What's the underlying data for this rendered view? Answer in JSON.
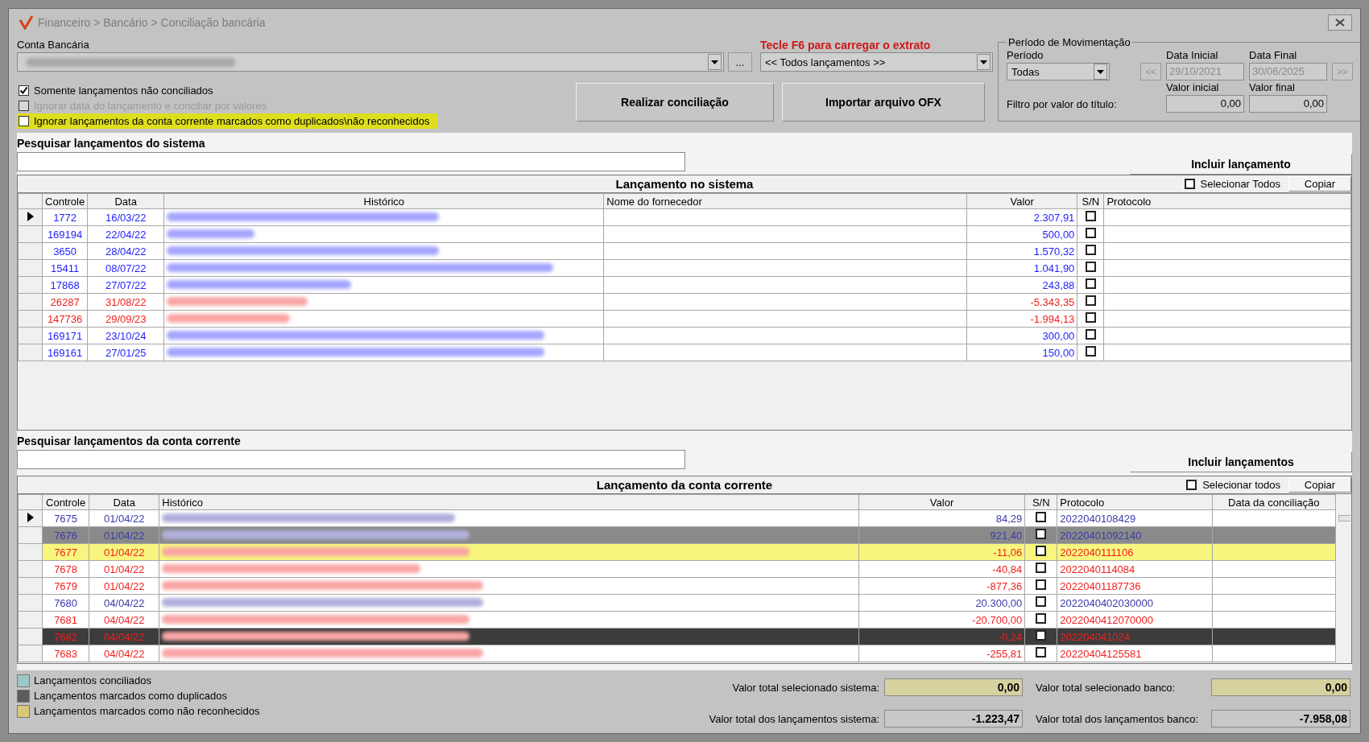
{
  "window": {
    "breadcrumb": "Financeiro > Bancário > Conciliação bancária"
  },
  "account": {
    "label": "Conta Bancária",
    "browse_button": "..."
  },
  "statement": {
    "hint": "Tecle F6 para carregar o extrato",
    "value": "<< Todos lançamentos >>"
  },
  "options": [
    {
      "label": "Somente lançamentos não conciliados",
      "checked": true,
      "disabled": false,
      "highlighted": false
    },
    {
      "label": "Ignorar data do lançamento e conciliar por valores",
      "checked": false,
      "disabled": true,
      "highlighted": false
    },
    {
      "label": "Ignorar lançamentos da conta corrente marcados como duplicados\\não reconhecidos",
      "checked": false,
      "disabled": false,
      "highlighted": true
    }
  ],
  "actions": [
    "Realizar conciliação",
    "Importar arquivo OFX"
  ],
  "period": {
    "title": "Período de Movimentação",
    "period_label": "Período",
    "period_value": "Todas",
    "start_label": "Data Inicial",
    "start_value": "29/10/2021",
    "end_label": "Data Final",
    "end_value": "30/06/2025",
    "prev_button": "<<",
    "next_button": ">>",
    "dates_disabled": true,
    "filter_label": "Filtro por valor do título:",
    "min_label": "Valor inicial",
    "min_value": "0,00",
    "max_label": "Valor final",
    "max_value": "0,00"
  },
  "system": {
    "search_label": "Pesquisar lançamentos do sistema",
    "add_button": "Incluir lançamento",
    "title": "Lançamento no sistema",
    "select_all": {
      "label": "Selecionar Todos",
      "checked": false
    },
    "copy_button": "Copiar",
    "columns": [
      "Controle",
      "Data",
      "Histórico",
      "Nome do fornecedor",
      "Valor",
      "S/N",
      "Protocolo"
    ],
    "rows": [
      {
        "controle": "1772",
        "data": "16/03/22",
        "valor": "2.307,91",
        "kind": "credit",
        "checked": false,
        "current": true
      },
      {
        "controle": "169194",
        "data": "22/04/22",
        "valor": "500,00",
        "kind": "credit",
        "checked": false,
        "current": false
      },
      {
        "controle": "3650",
        "data": "28/04/22",
        "valor": "1.570,32",
        "kind": "credit",
        "checked": false,
        "current": false
      },
      {
        "controle": "15411",
        "data": "08/07/22",
        "valor": "1.041,90",
        "kind": "credit",
        "checked": false,
        "current": false
      },
      {
        "controle": "17868",
        "data": "27/07/22",
        "valor": "243,88",
        "kind": "credit",
        "checked": false,
        "current": false
      },
      {
        "controle": "26287",
        "data": "31/08/22",
        "valor": "-5.343,35",
        "kind": "debit",
        "checked": false,
        "current": false
      },
      {
        "controle": "147736",
        "data": "29/09/23",
        "valor": "-1.994,13",
        "kind": "debit",
        "checked": false,
        "current": false
      },
      {
        "controle": "169171",
        "data": "23/10/24",
        "valor": "300,00",
        "kind": "credit",
        "checked": false,
        "current": false
      },
      {
        "controle": "169161",
        "data": "27/01/25",
        "valor": "150,00",
        "kind": "credit",
        "checked": false,
        "current": false
      }
    ]
  },
  "bank": {
    "search_label": "Pesquisar lançamentos da conta corrente",
    "add_button": "Incluir lançamentos",
    "title": "Lançamento da conta corrente",
    "select_all": {
      "label": "Selecionar todos",
      "checked": false
    },
    "copy_button": "Copiar",
    "columns": [
      "Controle",
      "Data",
      "Histórico",
      "Valor",
      "S/N",
      "Protocolo",
      "Data da conciliação"
    ],
    "rows": [
      {
        "controle": "7675",
        "data": "01/04/22",
        "valor": "84,29",
        "protocolo": "2022040108429",
        "kind": "credit",
        "duplicated": false,
        "unrecognized": false,
        "checked": false,
        "current": true
      },
      {
        "controle": "7676",
        "data": "01/04/22",
        "valor": "921,40",
        "protocolo": "20220401092140",
        "kind": "credit",
        "duplicated": true,
        "unrecognized": false,
        "checked": false,
        "current": false
      },
      {
        "controle": "7677",
        "data": "01/04/22",
        "valor": "-11,06",
        "protocolo": "2022040111106",
        "kind": "debit",
        "duplicated": false,
        "unrecognized": true,
        "checked": false,
        "current": false
      },
      {
        "controle": "7678",
        "data": "01/04/22",
        "valor": "-40,84",
        "protocolo": "2022040114084",
        "kind": "debit",
        "duplicated": false,
        "unrecognized": false,
        "checked": false,
        "current": false
      },
      {
        "controle": "7679",
        "data": "01/04/22",
        "valor": "-877,36",
        "protocolo": "20220401187736",
        "kind": "debit",
        "duplicated": false,
        "unrecognized": false,
        "checked": false,
        "current": false
      },
      {
        "controle": "7680",
        "data": "04/04/22",
        "valor": "20.300,00",
        "protocolo": "2022040402030000",
        "kind": "credit",
        "duplicated": false,
        "unrecognized": false,
        "checked": false,
        "current": false
      },
      {
        "controle": "7681",
        "data": "04/04/22",
        "valor": "-20.700,00",
        "protocolo": "2022040412070000",
        "kind": "debit",
        "duplicated": false,
        "unrecognized": false,
        "checked": false,
        "current": false
      },
      {
        "controle": "7682",
        "data": "04/04/22",
        "valor": "-0,24",
        "protocolo": "202204041024",
        "kind": "debit",
        "duplicated": true,
        "unrecognized": false,
        "checked": false,
        "current": false
      },
      {
        "controle": "7683",
        "data": "04/04/22",
        "valor": "-255,81",
        "protocolo": "20220404125581",
        "kind": "debit",
        "duplicated": false,
        "unrecognized": false,
        "checked": false,
        "current": false
      }
    ]
  },
  "legend": [
    {
      "label": "Lançamentos conciliados",
      "color": "#9cc8c8"
    },
    {
      "label": "Lançamentos marcados como duplicados",
      "color": "#5c5c5c"
    },
    {
      "label": "Lançamentos marcados como não reconhecidos",
      "color": "#d8c878"
    }
  ],
  "totals": [
    {
      "label": "Valor total selecionado sistema:",
      "value": "0,00",
      "kind": "selected"
    },
    {
      "label": "Valor total selecionado banco:",
      "value": "0,00",
      "kind": "selected"
    },
    {
      "label": "Valor total dos lançamentos sistema:",
      "value": "-1.223,47",
      "kind": "total"
    },
    {
      "label": "Valor total dos lançamentos banco:",
      "value": "-7.958,08",
      "kind": "total"
    }
  ]
}
